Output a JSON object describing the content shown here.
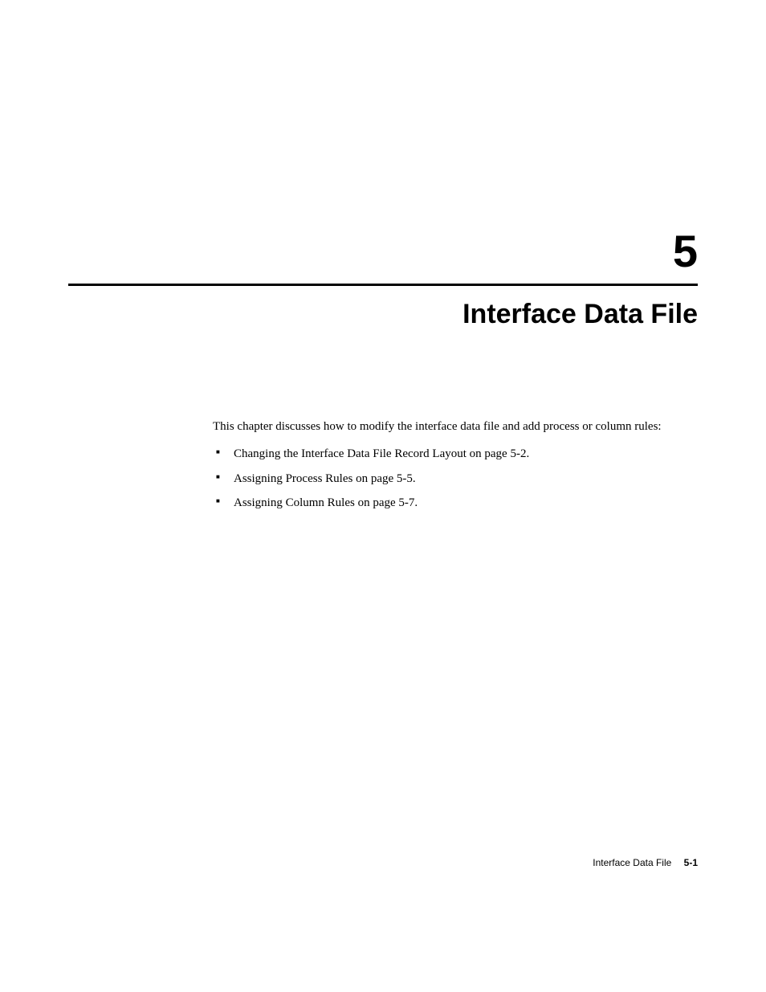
{
  "chapter": {
    "number": "5",
    "title": "Interface Data File"
  },
  "intro": "This chapter discusses how to modify the interface data file and add process or column rules:",
  "bullets": [
    "Changing the Interface Data File Record Layout on page 5-2.",
    "Assigning Process Rules on page 5-5.",
    "Assigning Column Rules on page 5-7."
  ],
  "footer": {
    "title": "Interface Data File",
    "page": "5-1"
  }
}
